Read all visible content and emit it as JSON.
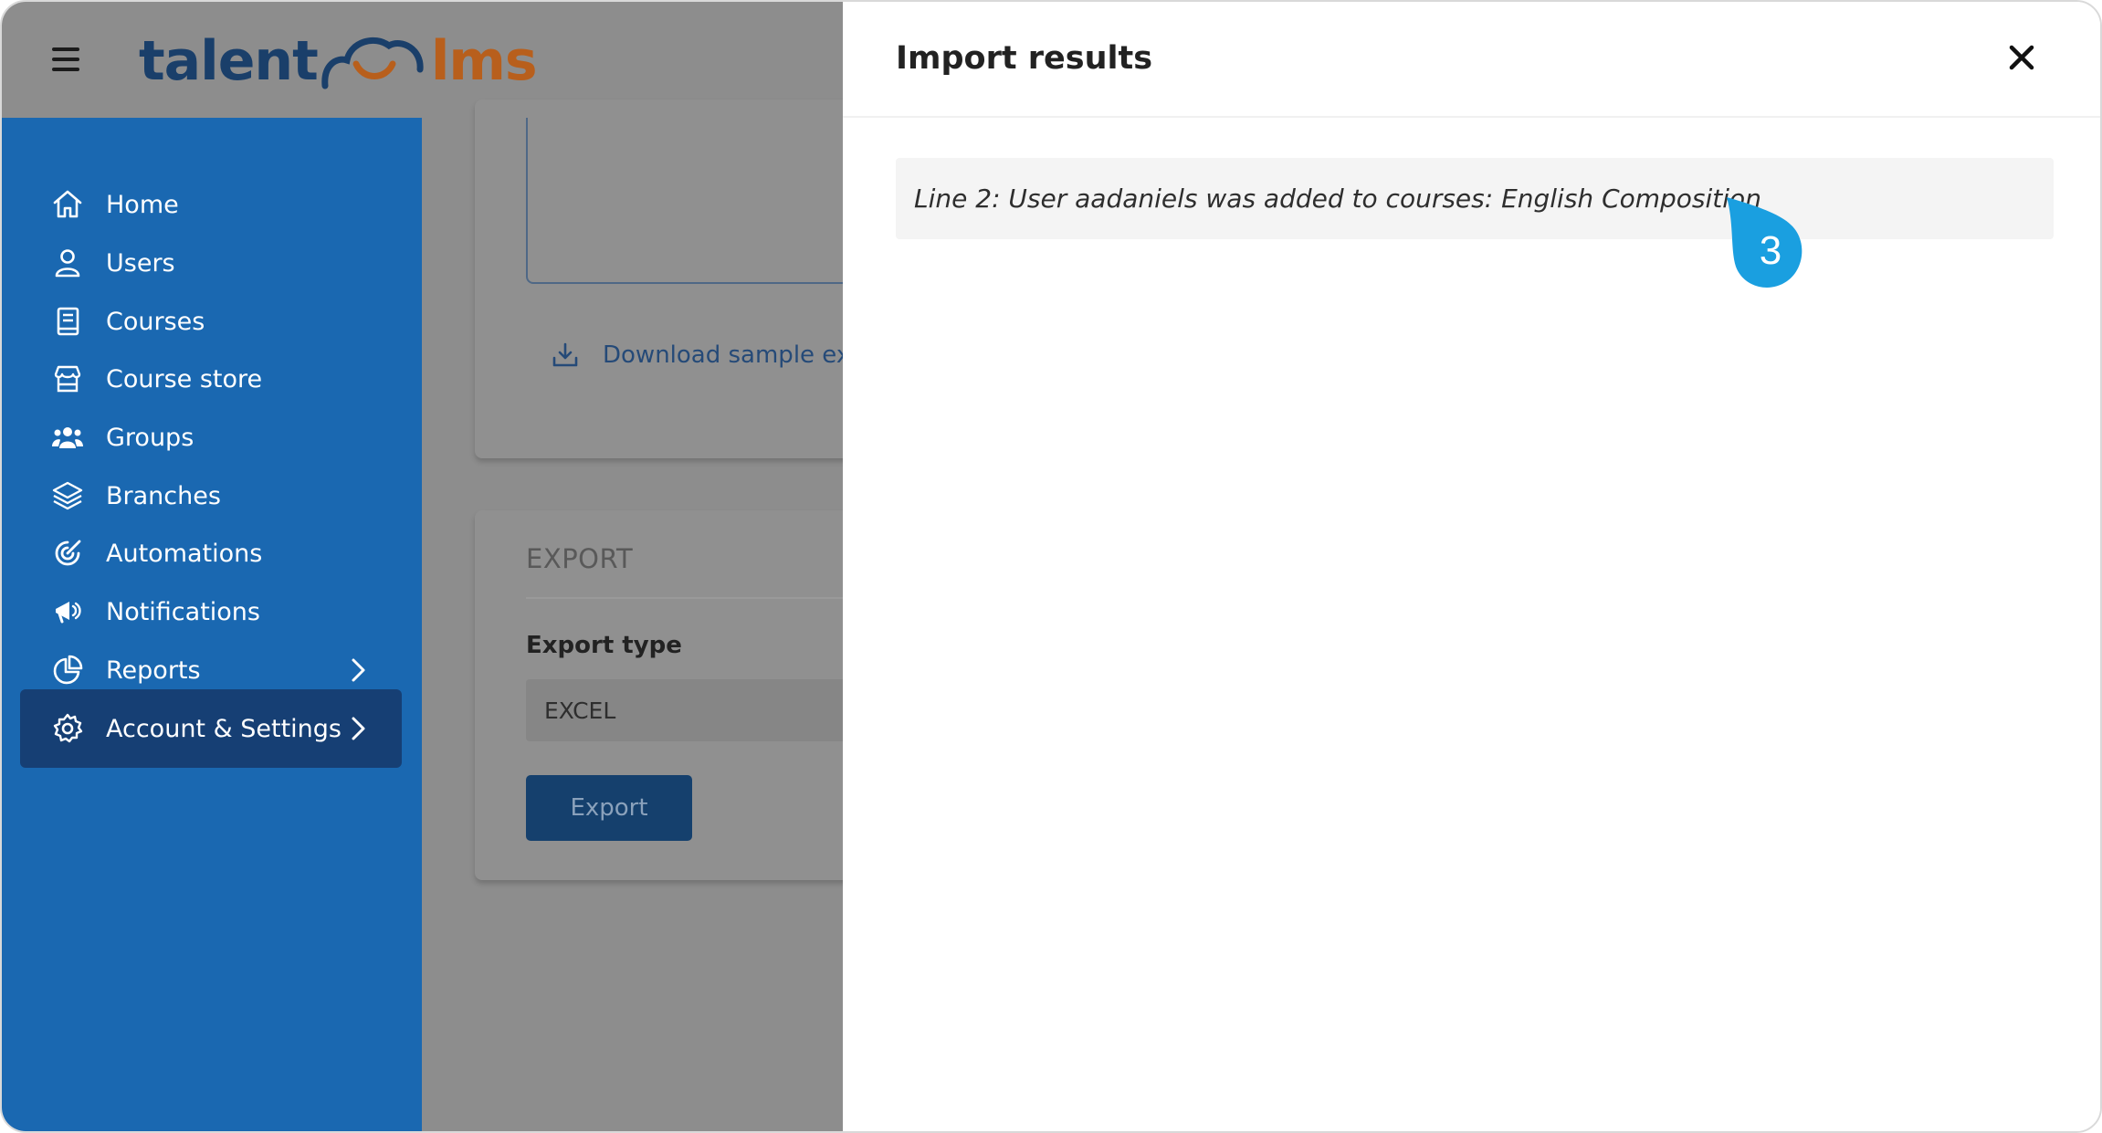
{
  "header": {
    "logo": {
      "left": "talent",
      "right": "lms"
    }
  },
  "sidebar": {
    "items": [
      {
        "label": "Home",
        "icon": "home-icon"
      },
      {
        "label": "Users",
        "icon": "user-icon"
      },
      {
        "label": "Courses",
        "icon": "book-icon"
      },
      {
        "label": "Course store",
        "icon": "store-icon"
      },
      {
        "label": "Groups",
        "icon": "groups-icon"
      },
      {
        "label": "Branches",
        "icon": "layers-icon"
      },
      {
        "label": "Automations",
        "icon": "automation-icon"
      },
      {
        "label": "Notifications",
        "icon": "megaphone-icon"
      },
      {
        "label": "Reports",
        "icon": "pie-chart-icon",
        "has_submenu": true
      },
      {
        "label": "Account & Settings",
        "icon": "gear-icon",
        "has_submenu": true,
        "active": true
      }
    ]
  },
  "content": {
    "download_link": "Download sample exc",
    "export": {
      "heading": "EXPORT",
      "type_label": "Export type",
      "type_value": "EXCEL",
      "button_label": "Export"
    }
  },
  "panel": {
    "title": "Import results",
    "results": [
      "Line 2: User aadaniels was added to courses: English Composition"
    ]
  },
  "annotation": {
    "step": "3",
    "color": "#1a9fe0"
  },
  "colors": {
    "sidebar": "#1a68b1",
    "sidebar_active": "#163f74",
    "overlay": "#8d8d8d",
    "logo_blue": "#1a3f6a",
    "logo_orange": "#b85f1c"
  }
}
